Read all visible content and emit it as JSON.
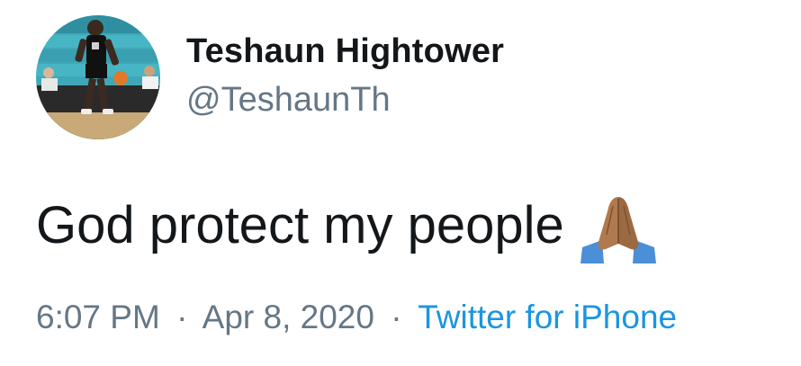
{
  "user": {
    "display_name": "Teshaun Hightower",
    "handle": "@TeshaunTh"
  },
  "tweet": {
    "text": "God protect my people",
    "emoji_icon": "folded-hands-icon"
  },
  "meta": {
    "time": "6:07 PM",
    "separator": "·",
    "date": "Apr 8, 2020",
    "source": "Twitter for iPhone"
  },
  "colors": {
    "name": "#14171a",
    "secondary": "#657786",
    "link": "#1b95e0",
    "background": "#ffffff"
  }
}
